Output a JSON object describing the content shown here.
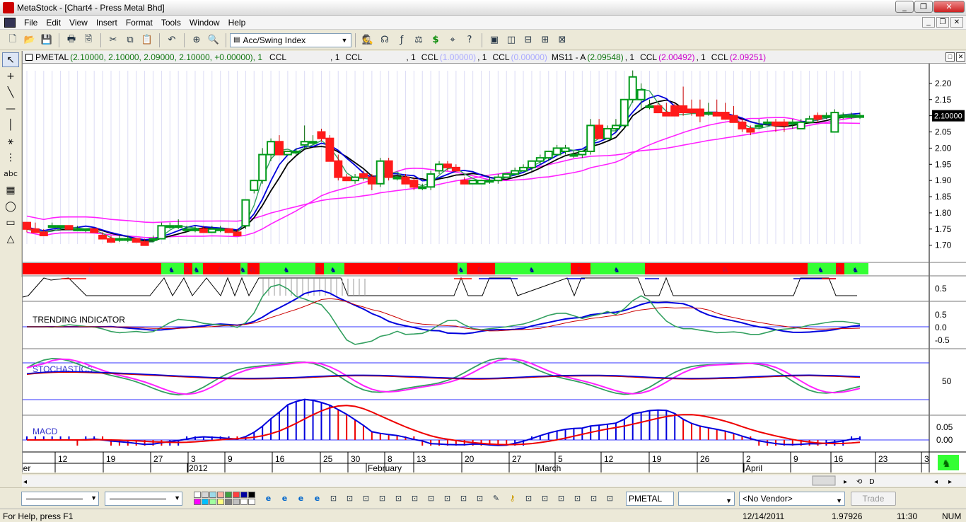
{
  "window": {
    "title": "MetaStock - [Chart4 - Press Metal Bhd]"
  },
  "window_buttons": [
    "_",
    "❐",
    "✕"
  ],
  "mdi_buttons": [
    "_",
    "❐",
    "✕"
  ],
  "menu": [
    "File",
    "Edit",
    "View",
    "Insert",
    "Format",
    "Tools",
    "Window",
    "Help"
  ],
  "toolbar": {
    "indicator": "Acc/Swing Index"
  },
  "legend": {
    "symbol": "PMETAL",
    "values": "(2.10000, 2.10000, 2.09000, 2.10000, +0.00000), 1",
    "ccl": "CCL",
    "items": [
      {
        "text": ", 1",
        "label": "CCL",
        "color": "#000000"
      },
      {
        "text": ", 1",
        "label": "CCL",
        "value": "(1.00000)",
        "vcolor": "#aaaaaa"
      },
      {
        "text": ", 1",
        "label": "CCL",
        "value": "(0.00000)",
        "vcolor": "#aaaaaa"
      }
    ],
    "ms": "MS11 - A",
    "ms_value": "(2.09548)",
    "ms_tail": ", 1",
    "ms_ccl": "CCL",
    "ms_v2": "(2.00492)",
    "ms_tail2": ", 1",
    "ms_ccl2": "CCL",
    "ms_v3": "(2.09251)"
  },
  "panels": {
    "trending": "TRENDING INDICATOR",
    "stochastics": "STOCHASTICS",
    "macd": "MACD"
  },
  "price_axis": [
    "2.20",
    "2.15",
    "2.10",
    "2.05",
    "2.00",
    "1.95",
    "1.90",
    "1.85",
    "1.80",
    "1.75",
    "1.70"
  ],
  "last_price": "2.10000",
  "panel_axes": {
    "sar": [
      "0.5"
    ],
    "trending": [
      "0.5",
      "0.0",
      "-0.5"
    ],
    "stoch": [
      "50"
    ],
    "macd": [
      "0.05",
      "0.00"
    ]
  },
  "date_axis": {
    "days": [
      "12",
      "19",
      "27",
      "3",
      "9",
      "16",
      "25",
      "30",
      "8",
      "13",
      "20",
      "27",
      "5",
      "12",
      "19",
      "26",
      "2",
      "9",
      "16",
      "23",
      "3"
    ],
    "months": [
      "ber",
      "2012",
      "February",
      "March",
      "April"
    ]
  },
  "zoom_buttons": [
    "⟲",
    "D",
    "◂",
    "▸"
  ],
  "bottom": {
    "symbol": "PMETAL",
    "vendor": "<No Vendor>",
    "trade": "Trade",
    "palette": [
      "#ffffff",
      "#d6d6d6",
      "#9cd9e8",
      "#ffb0a0",
      "#40a040",
      "#ff4040",
      "#0000a0",
      "#000000",
      "#ff00ff",
      "#00c0ff",
      "#a0ffa0",
      "#ffff80",
      "#808080",
      "#c0c0c0",
      "#ffffff",
      "#ffffff"
    ]
  },
  "status": {
    "help": "For Help, press F1",
    "date": "12/14/2011",
    "value": "1.97926",
    "time": "11:30",
    "num": "NUM"
  },
  "colors": {
    "up": "#009a1a",
    "down": "#ff1a1a",
    "blue": "#0000dd",
    "magenta": "#ff22ff",
    "green_line": "#33a060",
    "band_green": "#33ff33"
  },
  "chart_data": {
    "type": "candlestick",
    "price_range": [
      1.66,
      2.25
    ],
    "candles": [
      [
        1.77,
        1.77,
        1.74,
        1.75
      ],
      [
        1.75,
        1.77,
        1.74,
        1.74
      ],
      [
        1.74,
        1.75,
        1.73,
        1.73
      ],
      [
        1.76,
        1.77,
        1.76,
        1.76
      ],
      [
        1.76,
        1.76,
        1.75,
        1.76
      ],
      [
        1.76,
        1.76,
        1.75,
        1.75
      ],
      [
        1.75,
        1.76,
        1.75,
        1.75
      ],
      [
        1.75,
        1.75,
        1.74,
        1.75
      ],
      [
        1.75,
        1.75,
        1.74,
        1.74
      ],
      [
        1.73,
        1.74,
        1.72,
        1.72
      ],
      [
        1.72,
        1.73,
        1.71,
        1.71
      ],
      [
        1.72,
        1.73,
        1.71,
        1.72
      ],
      [
        1.72,
        1.73,
        1.71,
        1.72
      ],
      [
        1.72,
        1.72,
        1.71,
        1.71
      ],
      [
        1.71,
        1.72,
        1.7,
        1.7
      ],
      [
        1.72,
        1.73,
        1.71,
        1.72
      ],
      [
        1.72,
        1.77,
        1.72,
        1.76
      ],
      [
        1.76,
        1.77,
        1.75,
        1.76
      ],
      [
        1.76,
        1.78,
        1.75,
        1.76
      ],
      [
        1.75,
        1.76,
        1.74,
        1.75
      ],
      [
        1.75,
        1.76,
        1.74,
        1.75
      ],
      [
        1.75,
        1.76,
        1.74,
        1.74
      ],
      [
        1.74,
        1.76,
        1.74,
        1.75
      ],
      [
        1.75,
        1.76,
        1.74,
        1.75
      ],
      [
        1.75,
        1.75,
        1.74,
        1.74
      ],
      [
        1.74,
        1.75,
        1.73,
        1.73
      ],
      [
        1.76,
        1.84,
        1.75,
        1.84
      ],
      [
        1.87,
        1.9,
        1.86,
        1.9
      ],
      [
        1.9,
        2.0,
        1.89,
        1.98
      ],
      [
        1.98,
        2.03,
        1.96,
        2.02
      ],
      [
        2.02,
        2.04,
        1.98,
        1.98
      ],
      [
        1.98,
        1.99,
        1.98,
        1.99
      ],
      [
        1.99,
        2.0,
        1.98,
        1.99
      ],
      [
        2.01,
        2.07,
        2.0,
        2.02
      ],
      [
        2.02,
        2.04,
        2.01,
        2.02
      ],
      [
        2.05,
        2.06,
        2.02,
        2.03
      ],
      [
        2.03,
        2.04,
        1.98,
        1.96
      ],
      [
        1.96,
        1.98,
        1.9,
        1.91
      ],
      [
        1.91,
        1.92,
        1.9,
        1.9
      ],
      [
        1.9,
        1.92,
        1.89,
        1.91
      ],
      [
        1.92,
        1.93,
        1.9,
        1.91
      ],
      [
        1.91,
        1.92,
        1.87,
        1.89
      ],
      [
        1.89,
        1.97,
        1.88,
        1.96
      ],
      [
        1.96,
        1.97,
        1.9,
        1.91
      ],
      [
        1.91,
        1.92,
        1.9,
        1.91
      ],
      [
        1.91,
        1.92,
        1.89,
        1.89
      ],
      [
        1.9,
        1.91,
        1.87,
        1.88
      ],
      [
        1.88,
        1.89,
        1.87,
        1.88
      ],
      [
        1.88,
        1.93,
        1.87,
        1.92
      ],
      [
        1.93,
        1.96,
        1.92,
        1.95
      ],
      [
        1.95,
        1.96,
        1.93,
        1.94
      ],
      [
        1.94,
        1.95,
        1.93,
        1.93
      ],
      [
        1.9,
        1.91,
        1.89,
        1.89
      ],
      [
        1.89,
        1.9,
        1.89,
        1.9
      ],
      [
        1.89,
        1.9,
        1.89,
        1.9
      ],
      [
        1.9,
        1.91,
        1.89,
        1.9
      ],
      [
        1.9,
        1.92,
        1.89,
        1.91
      ],
      [
        1.91,
        1.92,
        1.91,
        1.92
      ],
      [
        1.92,
        1.94,
        1.92,
        1.93
      ],
      [
        1.93,
        1.95,
        1.93,
        1.94
      ],
      [
        1.94,
        1.96,
        1.93,
        1.96
      ],
      [
        1.96,
        1.98,
        1.95,
        1.97
      ],
      [
        1.97,
        1.99,
        1.96,
        1.99
      ],
      [
        1.98,
        2.01,
        1.98,
        2.0
      ],
      [
        1.99,
        2.01,
        1.98,
        2.0
      ],
      [
        1.98,
        1.99,
        1.97,
        1.98
      ],
      [
        1.98,
        1.99,
        1.97,
        1.99
      ],
      [
        1.99,
        2.09,
        1.98,
        2.07
      ],
      [
        2.07,
        2.09,
        2.03,
        2.03
      ],
      [
        2.03,
        2.07,
        2.03,
        2.06
      ],
      [
        2.06,
        2.09,
        2.05,
        2.07
      ],
      [
        2.07,
        2.15,
        2.06,
        2.15
      ],
      [
        2.15,
        2.24,
        2.14,
        2.22
      ],
      [
        2.15,
        2.2,
        2.12,
        2.18
      ],
      [
        2.13,
        2.15,
        2.12,
        2.13
      ],
      [
        2.13,
        2.14,
        2.11,
        2.11
      ],
      [
        2.11,
        2.14,
        2.1,
        2.1
      ],
      [
        2.13,
        2.14,
        2.1,
        2.1
      ],
      [
        2.13,
        2.19,
        2.1,
        2.11
      ],
      [
        2.12,
        2.15,
        2.1,
        2.11
      ],
      [
        2.12,
        2.15,
        2.08,
        2.1
      ],
      [
        2.11,
        2.14,
        2.1,
        2.11
      ],
      [
        2.11,
        2.15,
        2.1,
        2.1
      ],
      [
        2.11,
        2.14,
        2.09,
        2.09
      ],
      [
        2.1,
        2.13,
        2.08,
        2.08
      ],
      [
        2.08,
        2.09,
        2.05,
        2.06
      ],
      [
        2.06,
        2.07,
        2.04,
        2.05
      ],
      [
        2.07,
        2.09,
        2.06,
        2.07
      ],
      [
        2.08,
        2.09,
        2.07,
        2.08
      ],
      [
        2.08,
        2.09,
        2.05,
        2.07
      ],
      [
        2.08,
        2.09,
        2.05,
        2.07
      ],
      [
        2.08,
        2.09,
        2.06,
        2.08
      ],
      [
        2.06,
        2.09,
        2.06,
        2.08
      ],
      [
        2.08,
        2.1,
        2.08,
        2.09
      ],
      [
        2.1,
        2.11,
        2.08,
        2.09
      ],
      [
        2.1,
        2.11,
        2.09,
        2.1
      ],
      [
        2.05,
        2.12,
        2.05,
        2.11
      ],
      [
        2.1,
        2.11,
        2.09,
        2.1
      ],
      [
        2.1,
        2.11,
        2.09,
        2.1
      ],
      [
        2.1,
        2.11,
        2.09,
        2.1
      ]
    ],
    "bands": [
      [
        "r",
        0,
        196
      ],
      [
        "g",
        196,
        228
      ],
      [
        "r",
        228,
        240
      ],
      [
        "g",
        240,
        255
      ],
      [
        "r",
        255,
        308
      ],
      [
        "g",
        308,
        318
      ],
      [
        "r",
        318,
        335
      ],
      [
        "g",
        335,
        414
      ],
      [
        "r",
        414,
        426
      ],
      [
        "g",
        426,
        455
      ],
      [
        "r",
        455,
        615
      ],
      [
        "g",
        615,
        628
      ],
      [
        "r",
        628,
        668
      ],
      [
        "g",
        668,
        775
      ],
      [
        "r",
        775,
        803
      ],
      [
        "g",
        803,
        880
      ],
      [
        "r",
        880,
        1110
      ],
      [
        "g",
        1110,
        1150
      ],
      [
        "r",
        1150,
        1162
      ],
      [
        "g",
        1162,
        1196
      ]
    ]
  }
}
